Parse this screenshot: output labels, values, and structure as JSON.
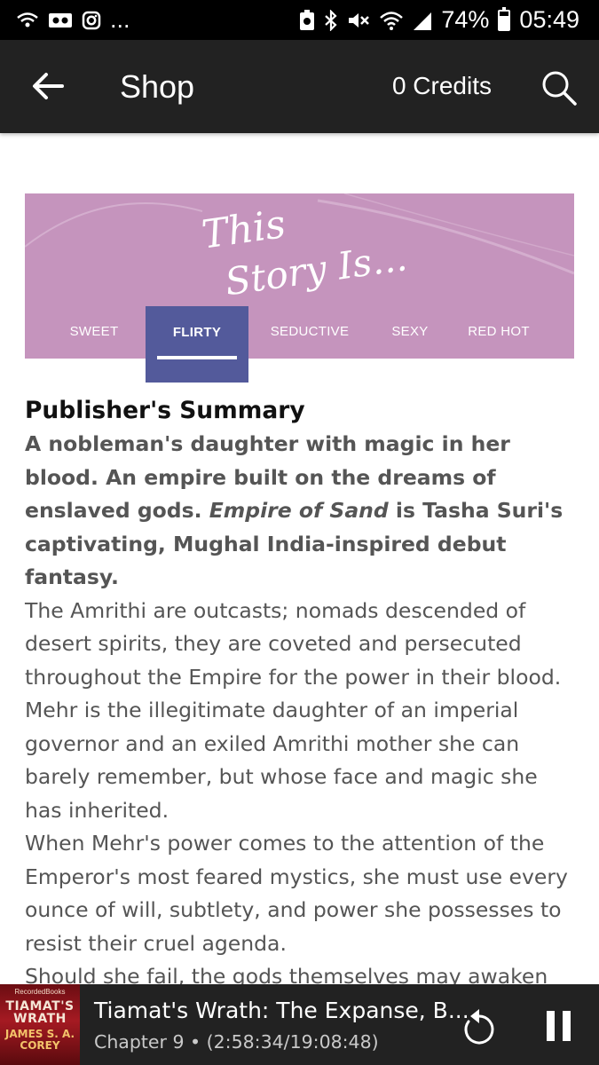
{
  "status_bar": {
    "left_icons": [
      "wifi-call-icon",
      "voicemail-icon",
      "instagram-icon"
    ],
    "more": "...",
    "right_icons": [
      "saver-icon",
      "bluetooth-icon",
      "mute-icon",
      "wifi-icon",
      "signal-icon"
    ],
    "battery": "74%",
    "battery_level": 0.74,
    "time": "05:49"
  },
  "app_bar": {
    "title": "Shop",
    "credits": "0 Credits",
    "back_icon": "arrow-back-icon",
    "search_icon": "search-icon"
  },
  "banner": {
    "heading_line1": "This",
    "heading_line2": "Story Is...",
    "color": "#c594bd",
    "active_color": "#535a9b",
    "tabs": [
      {
        "label": "SWEET",
        "active": false
      },
      {
        "label": "FLIRTY",
        "active": true
      },
      {
        "label": "SEDUCTIVE",
        "active": false
      },
      {
        "label": "SEXY",
        "active": false
      },
      {
        "label": "RED HOT",
        "active": false
      }
    ]
  },
  "summary": {
    "heading": "Publisher's Summary",
    "lead_part1": "A nobleman's daughter with magic in her blood. An empire built on the dreams of enslaved gods. ",
    "lead_italic": "Empire of Sand",
    "lead_part2": " is Tasha Suri's captivating, Mughal India-inspired debut fantasy.",
    "paragraphs": [
      "The Amrithi are outcasts; nomads descended of desert spirits, they are coveted and persecuted throughout the Empire for the power in their blood.",
      "Mehr is the illegitimate daughter of an imperial governor and an exiled Amrithi mother she can barely remember, but whose face and magic she has inherited.",
      "When Mehr's power comes to the attention of the Emperor's most feared mystics, she must use every ounce of will, subtlety, and power she possesses to resist their cruel agenda.",
      "Should she fail, the gods themselves may awaken seeking vengeance..."
    ]
  },
  "player": {
    "cover_publisher": "RecordedBooks",
    "cover_title_line1": "TIAMAT'S",
    "cover_title_line2": "WRATH",
    "cover_author_line1": "JAMES S. A.",
    "cover_author_line2": "COREY",
    "title": "Tiamat's Wrath: The Expanse, B...",
    "subtitle": "Chapter 9 • (2:58:34/19:08:48)",
    "replay_icon": "replay-icon",
    "pause_icon": "pause-icon"
  }
}
